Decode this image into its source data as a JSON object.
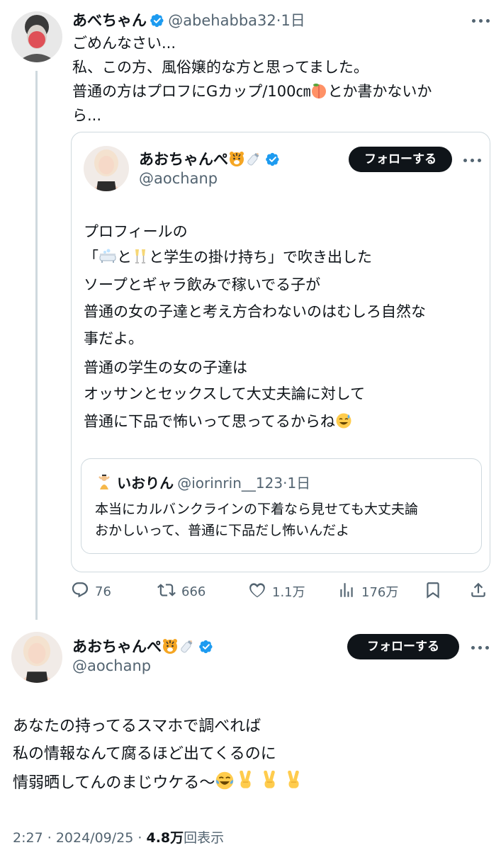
{
  "tweet1": {
    "name": "あべちゃん",
    "handle": "@abehabba32",
    "sep": "·",
    "time": "1日",
    "line1": "ごめんなさい...",
    "line2": "私、この方、風俗嬢的な方と思ってました。",
    "line3a": "普通の方はプロフにGカップ/100㎝",
    "line3b": "とか書かないか",
    "line4": "ら..."
  },
  "quote": {
    "name": "あおちゃんぺ",
    "handle": "@aochanp",
    "follow_label": "フォローする",
    "line1": "プロフィールの",
    "line2a": "「",
    "line2b": "と",
    "line2c": "と学生の掛け持ち」で吹き出した",
    "line3": "ソープとギャラ飲みで稼いでる子が",
    "line4": "普通の女の子達と考え方合わないのはむしろ自然な",
    "line5": "事だよ。",
    "line6": "普通の学生の女の子達は",
    "line7": "オッサンとセックスして大丈夫論に対して",
    "line8": "普通に下品で怖いって思ってるからね"
  },
  "nested": {
    "name": "いおりん",
    "handle": "@iorinrin__123",
    "sep": "·",
    "time": "1日",
    "line1": "本当にカルバンクラインの下着なら見せても大丈夫論",
    "line2": "おかしいって、普通に下品だし怖いんだよ"
  },
  "actions": {
    "replies": "76",
    "retweets": "666",
    "likes": "1.1万",
    "views": "176万"
  },
  "tweet2": {
    "name": "あおちゃんぺ",
    "handle": "@aochanp",
    "follow_label": "フォローする",
    "line1": "あなたの持ってるスマホで調べれば",
    "line2": "私の情報なんて腐るほど出てくるのに",
    "line3": "情弱晒してんのまじウケる〜"
  },
  "footer": {
    "time": "2:27",
    "sep1": "·",
    "date": "2024/09/25",
    "sep2": "·",
    "views": "4.8万",
    "views_suffix": "回表示"
  },
  "colors": {
    "verified": "#1d9bf0",
    "text": "#0f1419",
    "muted": "#536471",
    "border": "#cfd9de"
  },
  "icons": [
    "verified-badge-icon",
    "more-options-icon",
    "reply-icon",
    "retweet-icon",
    "like-icon",
    "views-icon",
    "bookmark-icon",
    "share-icon",
    "tiger-emoji-icon",
    "baby-bottle-emoji-icon",
    "peach-emoji-icon",
    "bathtub-emoji-icon",
    "champagne-emoji-icon",
    "sweat-smile-emoji-icon",
    "tears-of-joy-emoji-icon",
    "victory-hand-emoji-icon",
    "genie-emoji-icon"
  ]
}
